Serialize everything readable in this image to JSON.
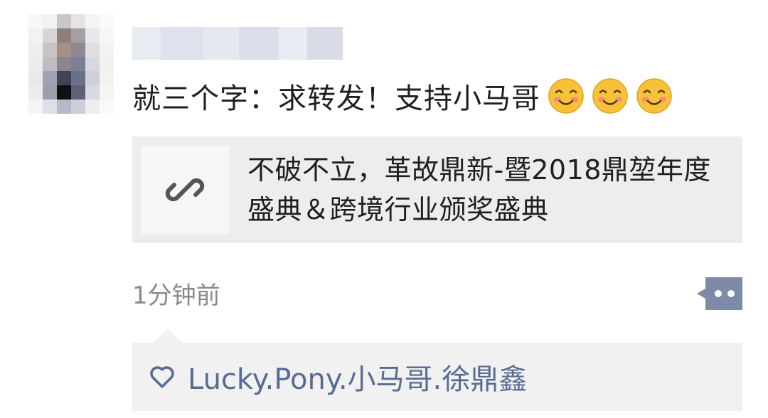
{
  "post": {
    "text": "就三个字：求转发！支持小马哥",
    "emojis": [
      "smiling-blush-emoji",
      "smiling-blush-emoji",
      "smiling-blush-emoji"
    ],
    "link": {
      "title": "不破不立，革故鼎新-暨2018鼎堃年度盛典＆跨境行业颁奖盛典",
      "icon": "link-icon"
    },
    "timestamp": "1分钟前",
    "likes": {
      "icon": "heart-outline-icon",
      "names": "Lucky.Pony.小马哥.徐鼎鑫"
    }
  },
  "colors": {
    "link_name": "#576b95",
    "card_bg": "#ededed",
    "action_btn": "#7d8aa8",
    "text": "#1f1f1f",
    "muted": "#8a8a8a"
  }
}
